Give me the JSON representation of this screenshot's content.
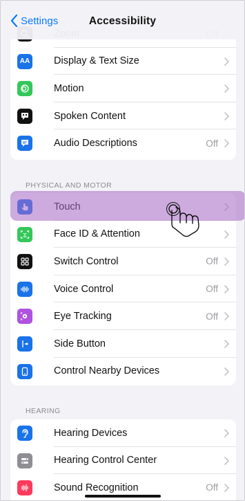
{
  "nav": {
    "back_label": "Settings",
    "title": "Accessibility"
  },
  "group_vision": [
    {
      "label": "Zoom",
      "value": "Off",
      "icon": "zoom-icon",
      "color": "#111111"
    },
    {
      "label": "Display & Text Size",
      "value": "",
      "icon": "text-size-icon",
      "color": "#1a73e8"
    },
    {
      "label": "Motion",
      "value": "",
      "icon": "motion-icon",
      "color": "#34c759"
    },
    {
      "label": "Spoken Content",
      "value": "",
      "icon": "speech-bubble-icon",
      "color": "#111111"
    },
    {
      "label": "Audio Descriptions",
      "value": "Off",
      "icon": "audio-description-icon",
      "color": "#1a73e8"
    }
  ],
  "section_physical": "PHYSICAL AND MOTOR",
  "group_physical": [
    {
      "label": "Touch",
      "value": "",
      "icon": "hand-touch-icon",
      "color": "#1a73e8"
    },
    {
      "label": "Face ID & Attention",
      "value": "",
      "icon": "face-id-icon",
      "color": "#34c759"
    },
    {
      "label": "Switch Control",
      "value": "Off",
      "icon": "switch-control-icon",
      "color": "#111111"
    },
    {
      "label": "Voice Control",
      "value": "Off",
      "icon": "voice-wave-icon",
      "color": "#1a73e8"
    },
    {
      "label": "Eye Tracking",
      "value": "Off",
      "icon": "eye-tracking-icon",
      "color": "#af52de"
    },
    {
      "label": "Side Button",
      "value": "",
      "icon": "side-button-icon",
      "color": "#1a73e8"
    },
    {
      "label": "Control Nearby Devices",
      "value": "",
      "icon": "nearby-devices-icon",
      "color": "#1a73e8"
    }
  ],
  "section_hearing": "HEARING",
  "group_hearing": [
    {
      "label": "Hearing Devices",
      "value": "",
      "icon": "ear-icon",
      "color": "#1a73e8"
    },
    {
      "label": "Hearing Control Center",
      "value": "",
      "icon": "control-center-icon",
      "color": "#8e8e93"
    },
    {
      "label": "Sound Recognition",
      "value": "Off",
      "icon": "sound-recognition-icon",
      "color": "#ff3b5c"
    }
  ],
  "colors": {
    "accent": "#0a7aff",
    "highlight": "#a666c4"
  }
}
